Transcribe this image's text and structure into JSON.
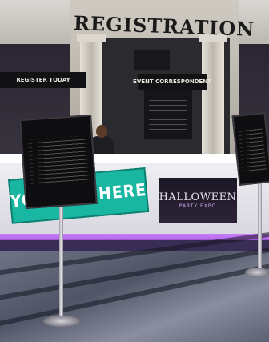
{
  "facade": {
    "title": "REGISTRATION"
  },
  "banners": {
    "left": "REGISTER TODAY",
    "center": "EVENT CORRESPONDENT",
    "small": ""
  },
  "counter_graphic": {
    "title": "HALLOWEEN",
    "subtitle": "PARTY EXPO"
  },
  "ad_panel": {
    "text": "YOUR AD HERE",
    "color": "#19b7a2"
  },
  "signs": {
    "left_title": "",
    "right_title": ""
  },
  "colors": {
    "counter_glow": "#c872ff",
    "counter": "#f1f0f4"
  }
}
